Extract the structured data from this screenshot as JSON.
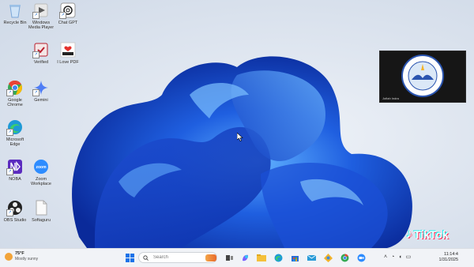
{
  "desktop": {
    "icons": [
      {
        "label": "Recycle Bin",
        "icon": "recycle-bin-icon",
        "color": "#7aa6d8"
      },
      {
        "label": "Windows Media Player",
        "icon": "media-player-icon",
        "color": "#c9c9c9"
      },
      {
        "label": "Chat GPT",
        "icon": "chatgpt-icon",
        "color": "#ffffff"
      },
      {
        "label": "Verified",
        "icon": "verified-app-icon",
        "color": "#b81f2e"
      },
      {
        "label": "I Love PDF",
        "icon": "ilovepdf-icon",
        "color": "#e5322d"
      },
      {
        "label": "Google Chrome",
        "icon": "chrome-icon",
        "color": "#34a853"
      },
      {
        "label": "Gemini",
        "icon": "gemini-icon",
        "color": "#4f7df5"
      },
      {
        "label": "Microsoft Edge",
        "icon": "edge-icon",
        "color": "#1e9ad6"
      },
      {
        "label": "NOBA",
        "icon": "noba-icon",
        "color": "#5b2bbf"
      },
      {
        "label": "Zoom Workplace",
        "icon": "zoom-icon",
        "color": "#2d8cff"
      },
      {
        "label": "OBS Studio",
        "icon": "obs-icon",
        "color": "#222222"
      },
      {
        "label": "Softaguru",
        "icon": "document-file-icon",
        "color": "#f7f7f7"
      }
    ]
  },
  "overlay": {
    "logo_text": "BIMBEL LENTERA INKLUSI",
    "caption": "Jofiah Indra"
  },
  "tiktok": {
    "label": "TikTok"
  },
  "taskbar": {
    "weather": {
      "temp": "75°F",
      "condition": "Mostly sunny"
    },
    "search_placeholder": "Search",
    "pinned": [
      {
        "name": "task-view-icon",
        "color": "#444444"
      },
      {
        "name": "copilot-icon",
        "color": "#7b61ff"
      },
      {
        "name": "file-explorer-icon",
        "color": "#f5c03a"
      },
      {
        "name": "edge-taskbar-icon",
        "color": "#1e9ad6"
      },
      {
        "name": "store-icon",
        "color": "#2b6cd6"
      },
      {
        "name": "mail-icon",
        "color": "#2a9bd8"
      },
      {
        "name": "photos-icon",
        "color": "#f3b32a"
      },
      {
        "name": "chrome-taskbar-icon",
        "color": "#34a853"
      },
      {
        "name": "zoom-taskbar-icon",
        "color": "#2d8cff"
      }
    ],
    "clock": {
      "time": "11:14:4",
      "date": "1/31/2025"
    }
  },
  "colors": {
    "bloom_dark": "#0b2fa8",
    "bloom_mid": "#1f5fe0",
    "bloom_light": "#4fa0ff",
    "taskbar": "#f1f3f7"
  }
}
